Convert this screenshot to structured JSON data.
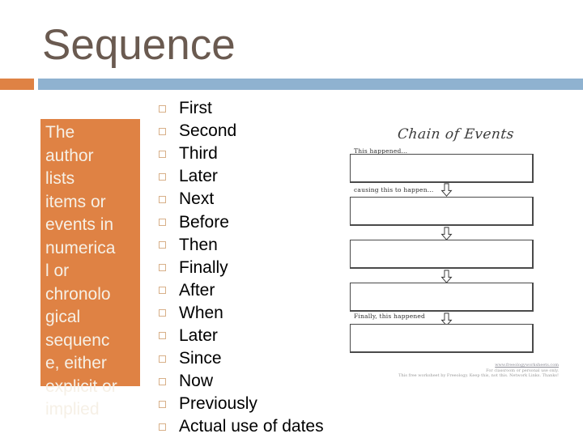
{
  "slide": {
    "title": "Sequence",
    "accent_orange": "#df8244",
    "accent_blue": "#8fb2d0",
    "title_color": "#6a5a50"
  },
  "callout": {
    "text": "The\nauthor\nlists\nitems or\nevents in\nnumerica\nl or\nchronolo\ngical\nsequenc\ne, either\nexplicit or\nimplied"
  },
  "bullets": {
    "marker_icon": "hollow-square-bullet-icon",
    "items": [
      {
        "label": "First"
      },
      {
        "label": "Second"
      },
      {
        "label": "Third"
      },
      {
        "label": "Later"
      },
      {
        "label": "Next"
      },
      {
        "label": "Before"
      },
      {
        "label": "Then"
      },
      {
        "label": "Finally"
      },
      {
        "label": "After"
      },
      {
        "label": "When"
      },
      {
        "label": "Later"
      },
      {
        "label": "Since"
      },
      {
        "label": "Now"
      },
      {
        "label": "Previously"
      },
      {
        "label": "Actual use of dates"
      }
    ]
  },
  "worksheet": {
    "title": "Chain of Events",
    "captions": {
      "first": "This happened...",
      "second": "causing this to happen...",
      "last": "Finally, this happened"
    },
    "boxes": [
      {
        "caption_key": "first"
      },
      {
        "caption_key": "second"
      },
      {
        "caption_key": ""
      },
      {
        "caption_key": ""
      },
      {
        "caption_key": "last"
      }
    ],
    "arrow_icon": "down-arrow-icon",
    "credit_line1": "www.freeologyworksheets.com",
    "credit_line2": "For classroom or personal use only.",
    "credit_line3": "This free worksheet by Freeology. Keep this, not this. Network Links. Thanks!"
  }
}
